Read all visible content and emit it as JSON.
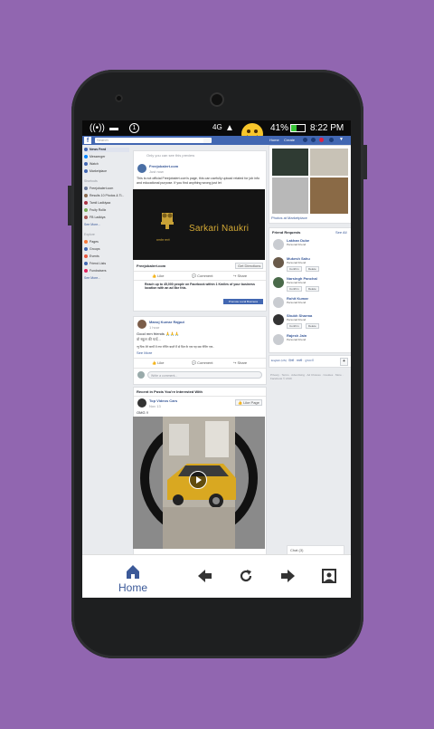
{
  "colors": {
    "background": "#9166b0",
    "fb_blue": "#4267b2",
    "accent": "#3b5998"
  },
  "status": {
    "battery": "41%",
    "time": "8:22 PM",
    "notif_count": "1"
  },
  "fb": {
    "search_placeholder": "Search",
    "header_links": [
      "Home",
      "Create"
    ]
  },
  "leftnav": {
    "items": [
      "News Feed",
      "Messenger",
      "Watch",
      "Marketplace"
    ],
    "explore_title": "Shortcuts",
    "shortcuts": [
      "Freejobalert.com",
      "Results 10 Photos & Ti...",
      "Tamil Ladkiyaa",
      "Fruity Rollix",
      "FB Ladkiya"
    ],
    "see_more": "See More...",
    "explore_header": "Explore",
    "explore": [
      "Pages",
      "Groups",
      "Events",
      "Friend Lists",
      "Fundraisers"
    ],
    "see_more2": "See More..."
  },
  "post1": {
    "top_line": "Only you can see this preview",
    "page_name": "Freejobalert.com",
    "time": "Just now",
    "body": "This is not official Freejobalert.com's page, this can usefully upload related for job info and educational purpose. If you find anything wrong just let",
    "image_title": "Sarkari Naukri",
    "image_subtitle": "सत्यमेव जयते",
    "link_domain": "Freejobalert.com",
    "link_button": "Get Directions",
    "actions": [
      "Like",
      "Comment",
      "Share"
    ],
    "promo": "Reach up to 45,000 people on Facebook within 1 Kmiles of your business location with an ad like this.",
    "promo_button": "Promote Local Business"
  },
  "post2": {
    "author": "Manoj Kumar Rajput",
    "time": "1 hour",
    "line1": "Good mrn friends 🙏🙏🙏",
    "line2": "वो स्कूल की यादें...",
    "line3": "न्यू पिक मेरे कार्यों में नया रोचिंग बदलें मैं दो दिल के एक यह सब रोचिंग एक..",
    "see_more": "See More",
    "actions": [
      "Like",
      "Comment",
      "Share"
    ],
    "comment_placeholder": "Write a comment..."
  },
  "post3": {
    "header": "Recent in Posts You're Interested With",
    "author": "Top Videos Cars",
    "time": "Nov 13",
    "caption": "OMG !!",
    "like_page": "Like Page"
  },
  "right": {
    "photos_link": "Photos at Marketplace",
    "friend_requests_title": "Friend Requests",
    "see_all": "See All",
    "friends": [
      {
        "name": "Lakhan Dube",
        "sub": "Personal Friend"
      },
      {
        "name": "Mukesh Sahu",
        "sub": "Personal Friend"
      },
      {
        "name": "Narsingh Panchal",
        "sub": "Personal Friend"
      },
      {
        "name": "Rohit Kumar",
        "sub": "Personal Friend"
      },
      {
        "name": "Shubh Sharma",
        "sub": "Personal Friend"
      },
      {
        "name": "Rajesh Jain",
        "sub": "Personal Friend"
      }
    ],
    "confirm": "Confirm",
    "delete": "Delete",
    "lang": "English (US) · हिन्दी · मराठी · ગુજરાતી",
    "footer": "Privacy · Terms · Advertising · Ad Choices · Cookies · More · Facebook © 2019",
    "chat": "Chat (3)"
  },
  "bottomnav": {
    "home_label": "Home"
  }
}
